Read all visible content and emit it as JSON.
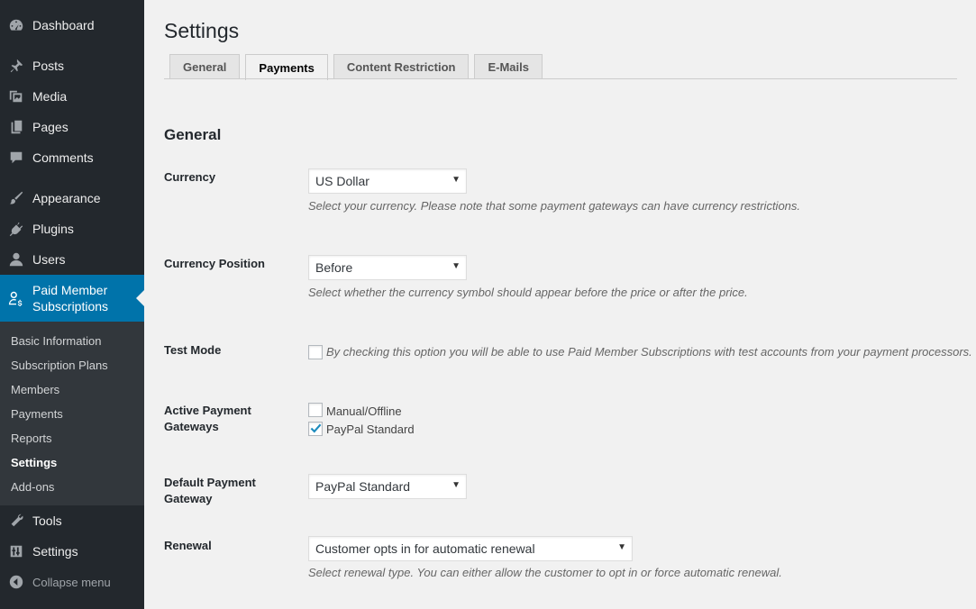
{
  "sidebar": {
    "items": [
      {
        "label": "Dashboard",
        "icon": "dashboard-icon"
      },
      {
        "label": "Posts",
        "icon": "pin-icon"
      },
      {
        "label": "Media",
        "icon": "media-icon"
      },
      {
        "label": "Pages",
        "icon": "pages-icon"
      },
      {
        "label": "Comments",
        "icon": "comment-icon"
      },
      {
        "label": "Appearance",
        "icon": "brush-icon"
      },
      {
        "label": "Plugins",
        "icon": "plugin-icon"
      },
      {
        "label": "Users",
        "icon": "user-icon"
      },
      {
        "label": "Paid Member Subscriptions",
        "icon": "member-subscription-icon"
      },
      {
        "label": "Tools",
        "icon": "wrench-icon"
      },
      {
        "label": "Settings",
        "icon": "sliders-icon"
      },
      {
        "label": "Collapse menu",
        "icon": "collapse-arrow-icon"
      }
    ],
    "submenu": [
      "Basic Information",
      "Subscription Plans",
      "Members",
      "Payments",
      "Reports",
      "Settings",
      "Add-ons"
    ],
    "active_submenu": "Settings",
    "active_color": "#0073aa"
  },
  "main": {
    "title": "Settings",
    "tabs": [
      "General",
      "Payments",
      "Content Restriction",
      "E-Mails"
    ],
    "active_tab": "Payments",
    "section_title": "General",
    "fields": {
      "currency": {
        "label": "Currency",
        "value": "US Dollar",
        "description": "Select your currency. Please note that some payment gateways can have currency restrictions."
      },
      "currency_position": {
        "label": "Currency Position",
        "value": "Before",
        "description": "Select whether the currency symbol should appear before the price or after the price."
      },
      "test_mode": {
        "label": "Test Mode",
        "checked": false,
        "description": "By checking this option you will be able to use Paid Member Subscriptions with test accounts from your payment processors."
      },
      "active_gateways": {
        "label": "Active Payment Gateways",
        "options": [
          {
            "label": "Manual/Offline",
            "checked": false
          },
          {
            "label": "PayPal Standard",
            "checked": true
          }
        ]
      },
      "default_gateway": {
        "label": "Default Payment Gateway",
        "value": "PayPal Standard"
      },
      "renewal": {
        "label": "Renewal",
        "value": "Customer opts in for automatic renewal",
        "description": "Select renewal type. You can either allow the customer to opt in or force automatic renewal."
      }
    },
    "dropdown_arrow": "▼"
  }
}
